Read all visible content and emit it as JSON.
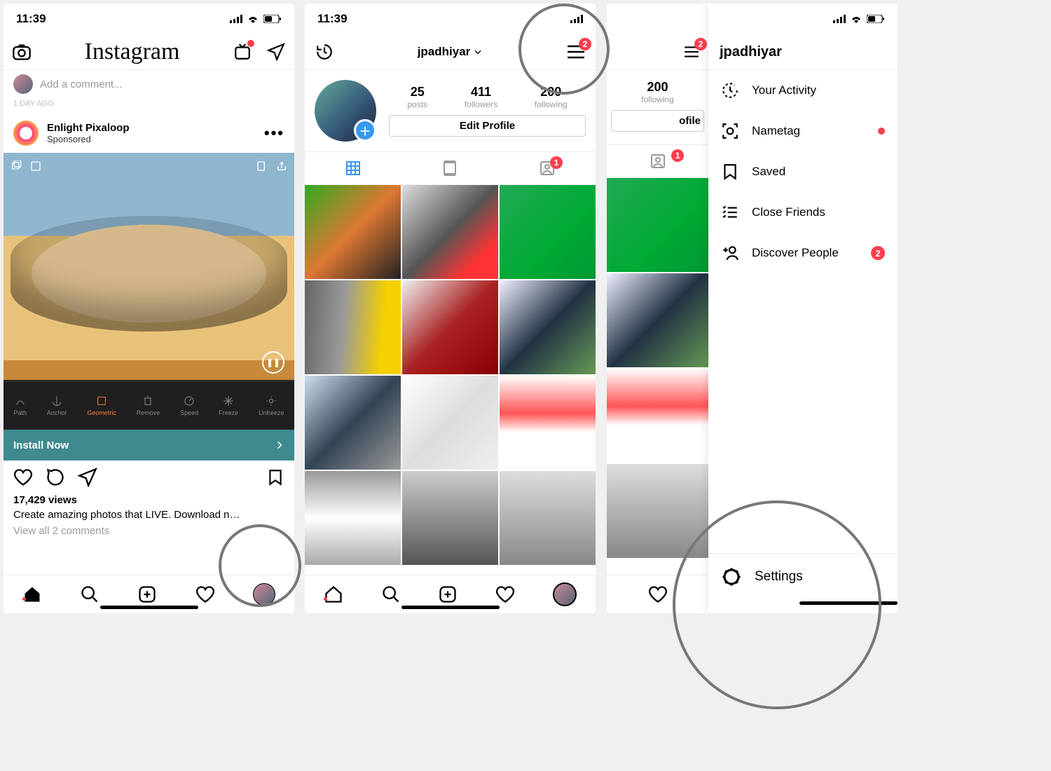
{
  "status": {
    "time": "11:39"
  },
  "feed": {
    "logo": "Instagram",
    "comment_placeholder": "Add a comment...",
    "timestamp": "1 DAY AGO",
    "sponsor_name": "Enlight Pixaloop",
    "sponsor_tag": "Sponsored",
    "install_label": "Install Now",
    "views": "17,429 views",
    "caption": "Create amazing photos that LIVE. Download n…",
    "view_comments": "View all 2 comments",
    "edit_tools": [
      "Path",
      "Anchor",
      "Geometric",
      "Remove",
      "Speed",
      "Freeze",
      "Unfreeze"
    ]
  },
  "profile": {
    "username": "jpadhiyar",
    "posts_n": "25",
    "posts_l": "posts",
    "followers_n": "411",
    "followers_l": "followers",
    "following_n": "200",
    "following_l": "following",
    "edit_label": "Edit Profile",
    "hamburger_badge": "2",
    "tagged_badge": "1"
  },
  "drawer": {
    "hamburger_badge": "2",
    "following_n": "200",
    "following_l": "following",
    "edit_fragment": "ofile",
    "username": "jpadhiyar",
    "items": {
      "activity": "Your Activity",
      "nametag": "Nametag",
      "saved": "Saved",
      "close": "Close Friends",
      "discover": "Discover People",
      "discover_badge": "2"
    },
    "settings": "Settings",
    "tagged_badge": "1"
  }
}
